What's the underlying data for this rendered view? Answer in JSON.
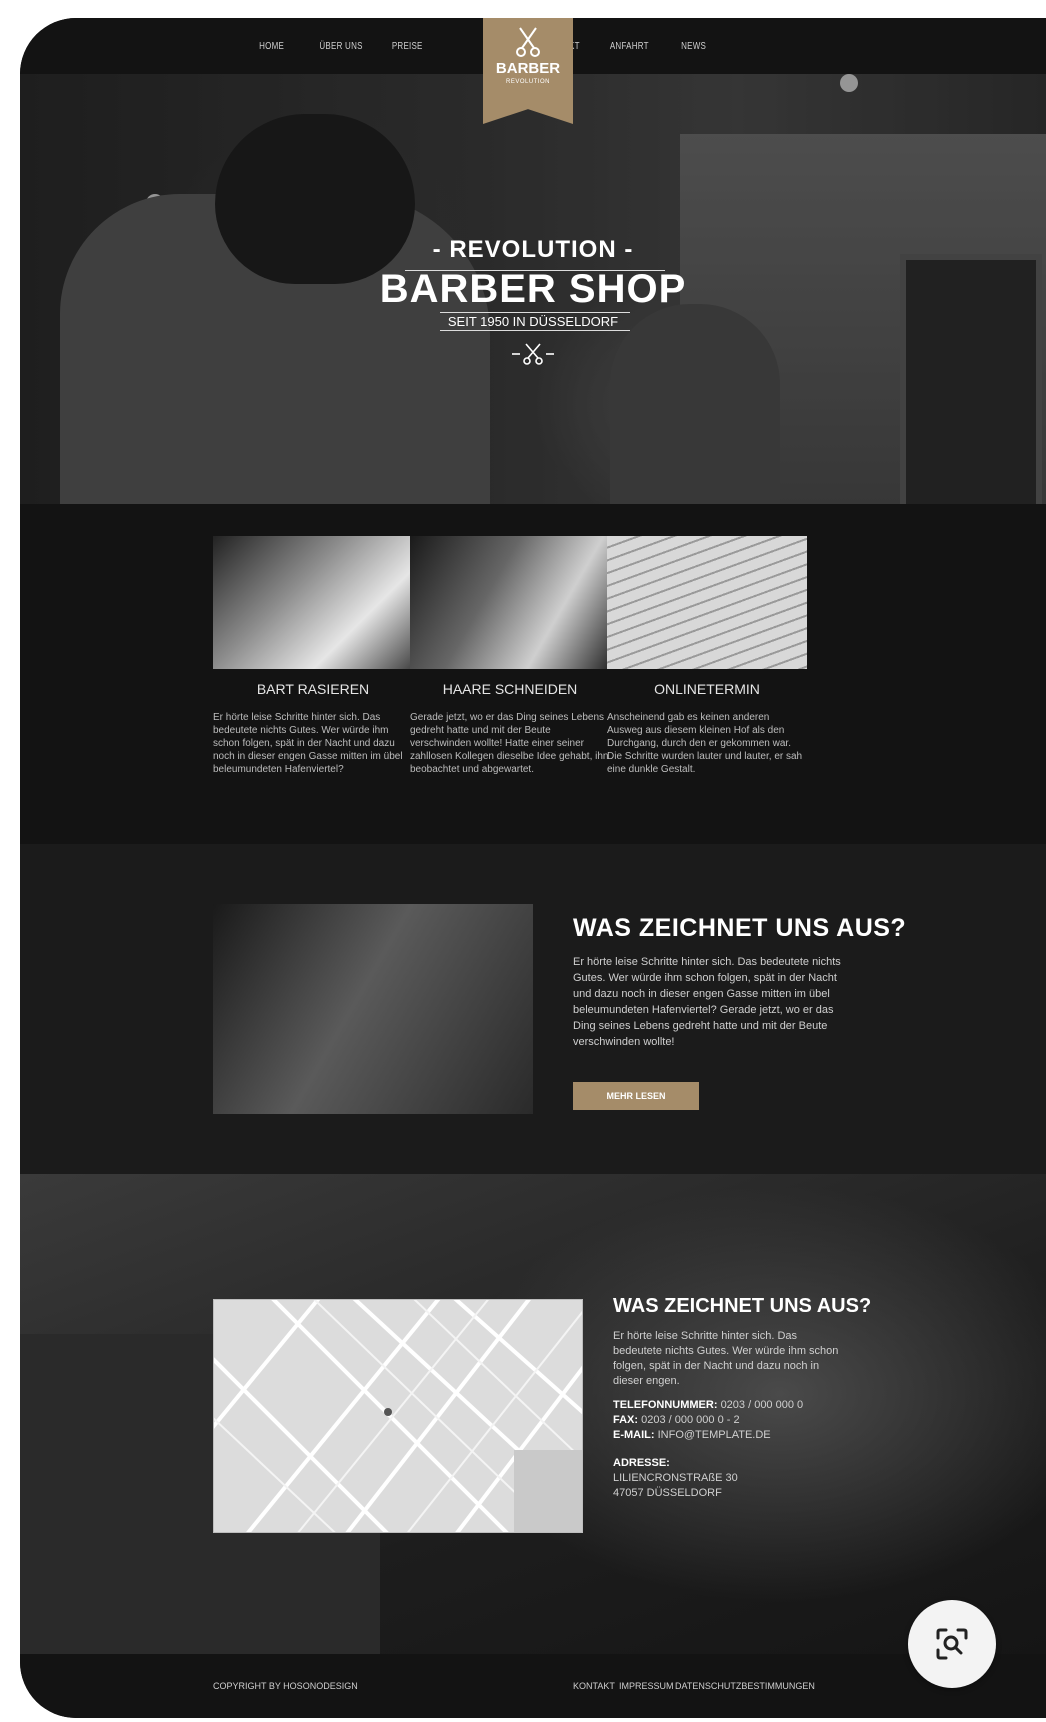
{
  "nav": {
    "left": [
      "HOME",
      "ÜBER UNS",
      "PREISE"
    ],
    "right": [
      "KONTAKT",
      "ANFAHRT",
      "NEWS"
    ]
  },
  "logo": {
    "name": "BARBER",
    "sub": "REVOLUTION"
  },
  "hero": {
    "kicker": "- REVOLUTION -",
    "title": "BARBER SHOP",
    "subtitle": "SEIT 1950 IN DÜSSELDORF",
    "icon": "scissors-icon"
  },
  "features": [
    {
      "title": "BART RASIEREN",
      "text": "Er hörte leise Schritte hinter sich. Das bedeutete nichts Gutes. Wer würde ihm schon folgen, spät in der Nacht und dazu noch in dieser engen Gasse mitten im übel beleumundeten Hafenviertel?"
    },
    {
      "title": "HAARE SCHNEIDEN",
      "text": "Gerade jetzt, wo er das Ding seines Lebens gedreht hatte und mit der Beute verschwinden wollte! Hatte einer seiner zahllosen Kollegen dieselbe Idee gehabt, ihn beobachtet und abgewartet."
    },
    {
      "title": "ONLINETERMIN",
      "text": "Anscheinend gab es keinen anderen Ausweg aus diesem kleinen Hof als den Durchgang, durch den er gekommen war. Die Schritte wurden lauter und lauter, er sah eine dunkle Gestalt."
    }
  ],
  "about": {
    "title": "WAS ZEICHNET UNS AUS?",
    "text": "Er hörte leise Schritte hinter sich. Das bedeutete nichts Gutes. Wer würde ihm schon folgen, spät in der Nacht und dazu noch in dieser engen Gasse mitten im übel beleumundeten Hafenviertel? Gerade jetzt, wo er das Ding seines Lebens gedreht hatte und mit der Beute verschwinden wollte!",
    "button": "MEHR LESEN"
  },
  "contact": {
    "title": "WAS ZEICHNET UNS AUS?",
    "text": "Er hörte leise Schritte hinter sich. Das bedeutete nichts Gutes. Wer würde ihm schon folgen, spät in der Nacht und dazu noch in dieser engen.",
    "phone_label": "TELEFONNUMMER:",
    "phone": "0203 / 000 000 0",
    "fax_label": "FAX:",
    "fax": "0203 / 000 000 0 - 2",
    "email_label": "E-MAIL:",
    "email": "INFO@TEMPLATE.DE",
    "address_label": "ADRESSE:",
    "address_street": "LILIENCRONSTRAßE 30",
    "address_city": "47057 DÜSSELDORF"
  },
  "footer": {
    "copyright": "COPYRIGHT BY HOSONODESIGN",
    "links": [
      "KONTAKT",
      "IMPRESSUM",
      "DATENSCHUTZBESTIMMUNGEN"
    ]
  },
  "colors": {
    "accent": "#a58c69",
    "background": "#131313",
    "section_alt": "#1b1b1b"
  }
}
